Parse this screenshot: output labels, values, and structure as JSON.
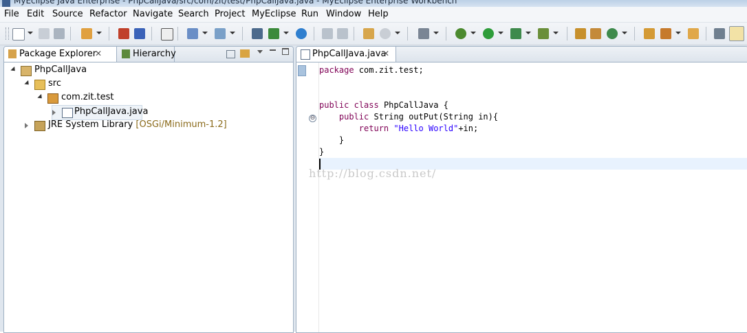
{
  "window": {
    "title": "MyEclipse Java Enterprise - PhpCallJava/src/com/zit/test/PhpCallJava.java - MyEclipse Enterprise Workbench"
  },
  "menu": [
    "File",
    "Edit",
    "Source",
    "Refactor",
    "Navigate",
    "Search",
    "Project",
    "MyEclipse",
    "Run",
    "Window",
    "Help"
  ],
  "package_explorer": {
    "tabs": [
      {
        "label": "Package Explorer",
        "close": "✕"
      },
      {
        "label": "Hierarchy"
      }
    ],
    "tree": [
      {
        "label": "PhpCallJava",
        "icon": "java-project-icon"
      },
      {
        "label": "src",
        "icon": "source-folder-icon"
      },
      {
        "label": "com.zit.test",
        "icon": "package-icon"
      },
      {
        "label": "PhpCallJava.java",
        "icon": "java-file-icon"
      },
      {
        "label": "JRE System Library",
        "decoration": "[OSGi/Minimum-1.2]",
        "icon": "library-icon"
      }
    ]
  },
  "editor": {
    "tab": {
      "label": "PhpCallJava.java",
      "close": "✕"
    },
    "code": {
      "l1_kw": "package",
      "l1_rest": " com.zit.test;",
      "l2_kw1": "public",
      "l2_kw2": "class",
      "l2_rest": " PhpCallJava {",
      "l3_kw": "public",
      "l3_rest": " String outPut(String in){",
      "l4_kw": "return",
      "l4_str": "\"Hello World\"",
      "l4_rest": "+in;",
      "l5": "    }",
      "l6": "}"
    },
    "fold_glyph": "⊖",
    "watermark": "http://blog.csdn.net/"
  },
  "colors": {
    "keyword": "#7f0055",
    "string": "#2a00ff",
    "current_line": "#e8f2fe",
    "tab_border": "#9fb0c3"
  },
  "toolbar_icons": [
    "new-icon",
    "save-icon",
    "print-icon",
    "new-project-icon",
    "open-type-icon",
    "build-icon",
    "web20-icon",
    "new-web-project-icon",
    "deploy-icon",
    "server-icon",
    "run-server-icon",
    "browser-icon",
    "open-file-icon",
    "search-icon",
    "screenshot-icon",
    "debug-icon",
    "run-icon",
    "coverage-icon",
    "external-tools-icon",
    "new-java-project-icon",
    "new-package-icon",
    "new-class-icon",
    "open-folder-icon",
    "pencil-icon",
    "forward-folder-icon",
    "pin-icon",
    "highlight-icon"
  ]
}
